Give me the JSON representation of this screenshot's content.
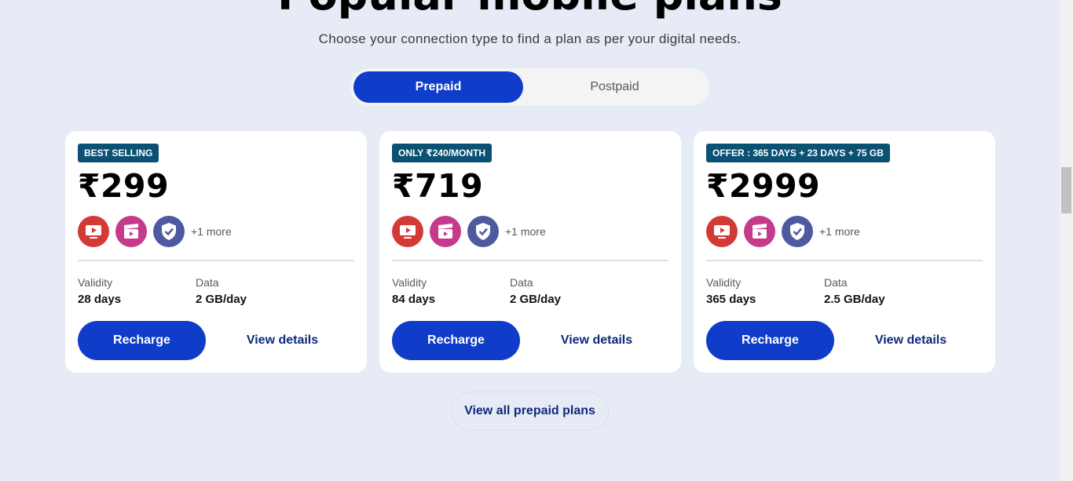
{
  "section": {
    "title": "Popular mobile plans",
    "subtitle": "Choose your connection type to find a plan as per your digital needs."
  },
  "toggle": {
    "options": [
      "Prepaid",
      "Postpaid"
    ],
    "selected": "Prepaid"
  },
  "plans": [
    {
      "badge": "BEST SELLING",
      "price": "₹299",
      "icons": [
        "youtube-play-icon",
        "cinema-clapper-icon",
        "shield-check-icon"
      ],
      "more": "+1 more",
      "validity_label": "Validity",
      "validity": "28 days",
      "data_label": "Data",
      "data": "2 GB/day",
      "recharge_label": "Recharge",
      "details_label": "View details"
    },
    {
      "badge": "ONLY ₹240/MONTH",
      "price": "₹719",
      "icons": [
        "youtube-play-icon",
        "cinema-clapper-icon",
        "shield-check-icon"
      ],
      "more": "+1 more",
      "validity_label": "Validity",
      "validity": "84 days",
      "data_label": "Data",
      "data": "2 GB/day",
      "recharge_label": "Recharge",
      "details_label": "View details"
    },
    {
      "badge": "OFFER : 365 DAYS + 23 DAYS + 75 GB",
      "price": "₹2999",
      "icons": [
        "youtube-play-icon",
        "cinema-clapper-icon",
        "shield-check-icon"
      ],
      "more": "+1 more",
      "validity_label": "Validity",
      "validity": "365 days",
      "data_label": "Data",
      "data": "2.5 GB/day",
      "recharge_label": "Recharge",
      "details_label": "View details"
    }
  ],
  "view_all_label": "View all prepaid plans",
  "colors": {
    "background": "#e6ebf6",
    "primary": "#0f3cc9",
    "badge": "#0a5174",
    "link": "#0d2a7a"
  }
}
